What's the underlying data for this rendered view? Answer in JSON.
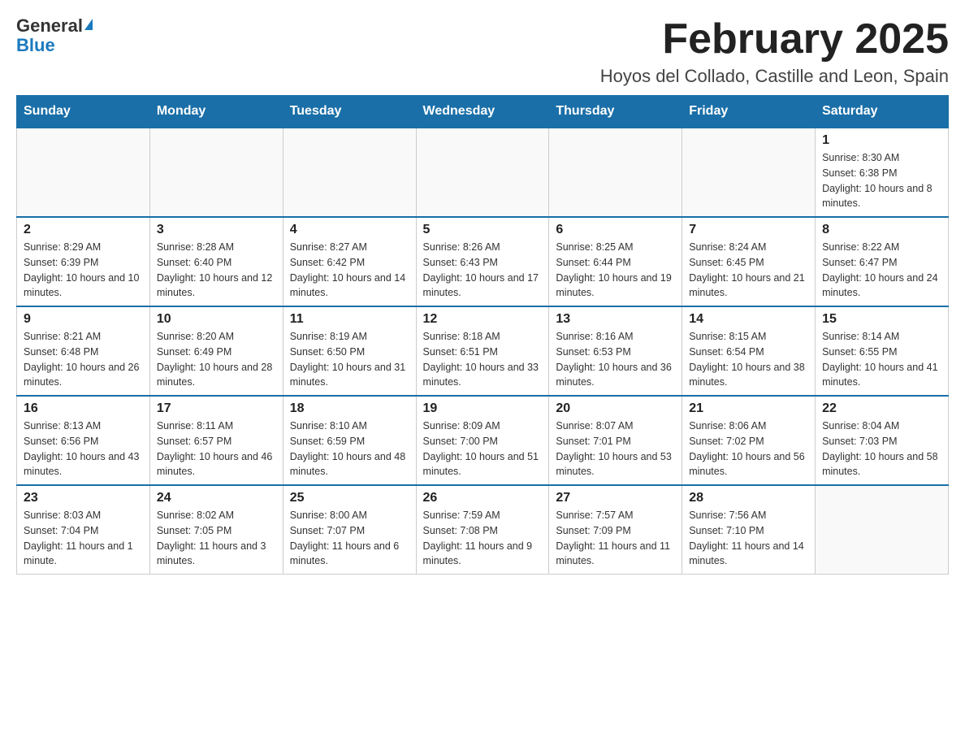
{
  "header": {
    "logo_general": "General",
    "logo_blue": "Blue",
    "month_title": "February 2025",
    "location": "Hoyos del Collado, Castille and Leon, Spain"
  },
  "weekdays": [
    "Sunday",
    "Monday",
    "Tuesday",
    "Wednesday",
    "Thursday",
    "Friday",
    "Saturday"
  ],
  "weeks": [
    [
      {
        "day": "",
        "info": ""
      },
      {
        "day": "",
        "info": ""
      },
      {
        "day": "",
        "info": ""
      },
      {
        "day": "",
        "info": ""
      },
      {
        "day": "",
        "info": ""
      },
      {
        "day": "",
        "info": ""
      },
      {
        "day": "1",
        "info": "Sunrise: 8:30 AM\nSunset: 6:38 PM\nDaylight: 10 hours and 8 minutes."
      }
    ],
    [
      {
        "day": "2",
        "info": "Sunrise: 8:29 AM\nSunset: 6:39 PM\nDaylight: 10 hours and 10 minutes."
      },
      {
        "day": "3",
        "info": "Sunrise: 8:28 AM\nSunset: 6:40 PM\nDaylight: 10 hours and 12 minutes."
      },
      {
        "day": "4",
        "info": "Sunrise: 8:27 AM\nSunset: 6:42 PM\nDaylight: 10 hours and 14 minutes."
      },
      {
        "day": "5",
        "info": "Sunrise: 8:26 AM\nSunset: 6:43 PM\nDaylight: 10 hours and 17 minutes."
      },
      {
        "day": "6",
        "info": "Sunrise: 8:25 AM\nSunset: 6:44 PM\nDaylight: 10 hours and 19 minutes."
      },
      {
        "day": "7",
        "info": "Sunrise: 8:24 AM\nSunset: 6:45 PM\nDaylight: 10 hours and 21 minutes."
      },
      {
        "day": "8",
        "info": "Sunrise: 8:22 AM\nSunset: 6:47 PM\nDaylight: 10 hours and 24 minutes."
      }
    ],
    [
      {
        "day": "9",
        "info": "Sunrise: 8:21 AM\nSunset: 6:48 PM\nDaylight: 10 hours and 26 minutes."
      },
      {
        "day": "10",
        "info": "Sunrise: 8:20 AM\nSunset: 6:49 PM\nDaylight: 10 hours and 28 minutes."
      },
      {
        "day": "11",
        "info": "Sunrise: 8:19 AM\nSunset: 6:50 PM\nDaylight: 10 hours and 31 minutes."
      },
      {
        "day": "12",
        "info": "Sunrise: 8:18 AM\nSunset: 6:51 PM\nDaylight: 10 hours and 33 minutes."
      },
      {
        "day": "13",
        "info": "Sunrise: 8:16 AM\nSunset: 6:53 PM\nDaylight: 10 hours and 36 minutes."
      },
      {
        "day": "14",
        "info": "Sunrise: 8:15 AM\nSunset: 6:54 PM\nDaylight: 10 hours and 38 minutes."
      },
      {
        "day": "15",
        "info": "Sunrise: 8:14 AM\nSunset: 6:55 PM\nDaylight: 10 hours and 41 minutes."
      }
    ],
    [
      {
        "day": "16",
        "info": "Sunrise: 8:13 AM\nSunset: 6:56 PM\nDaylight: 10 hours and 43 minutes."
      },
      {
        "day": "17",
        "info": "Sunrise: 8:11 AM\nSunset: 6:57 PM\nDaylight: 10 hours and 46 minutes."
      },
      {
        "day": "18",
        "info": "Sunrise: 8:10 AM\nSunset: 6:59 PM\nDaylight: 10 hours and 48 minutes."
      },
      {
        "day": "19",
        "info": "Sunrise: 8:09 AM\nSunset: 7:00 PM\nDaylight: 10 hours and 51 minutes."
      },
      {
        "day": "20",
        "info": "Sunrise: 8:07 AM\nSunset: 7:01 PM\nDaylight: 10 hours and 53 minutes."
      },
      {
        "day": "21",
        "info": "Sunrise: 8:06 AM\nSunset: 7:02 PM\nDaylight: 10 hours and 56 minutes."
      },
      {
        "day": "22",
        "info": "Sunrise: 8:04 AM\nSunset: 7:03 PM\nDaylight: 10 hours and 58 minutes."
      }
    ],
    [
      {
        "day": "23",
        "info": "Sunrise: 8:03 AM\nSunset: 7:04 PM\nDaylight: 11 hours and 1 minute."
      },
      {
        "day": "24",
        "info": "Sunrise: 8:02 AM\nSunset: 7:05 PM\nDaylight: 11 hours and 3 minutes."
      },
      {
        "day": "25",
        "info": "Sunrise: 8:00 AM\nSunset: 7:07 PM\nDaylight: 11 hours and 6 minutes."
      },
      {
        "day": "26",
        "info": "Sunrise: 7:59 AM\nSunset: 7:08 PM\nDaylight: 11 hours and 9 minutes."
      },
      {
        "day": "27",
        "info": "Sunrise: 7:57 AM\nSunset: 7:09 PM\nDaylight: 11 hours and 11 minutes."
      },
      {
        "day": "28",
        "info": "Sunrise: 7:56 AM\nSunset: 7:10 PM\nDaylight: 11 hours and 14 minutes."
      },
      {
        "day": "",
        "info": ""
      }
    ]
  ]
}
